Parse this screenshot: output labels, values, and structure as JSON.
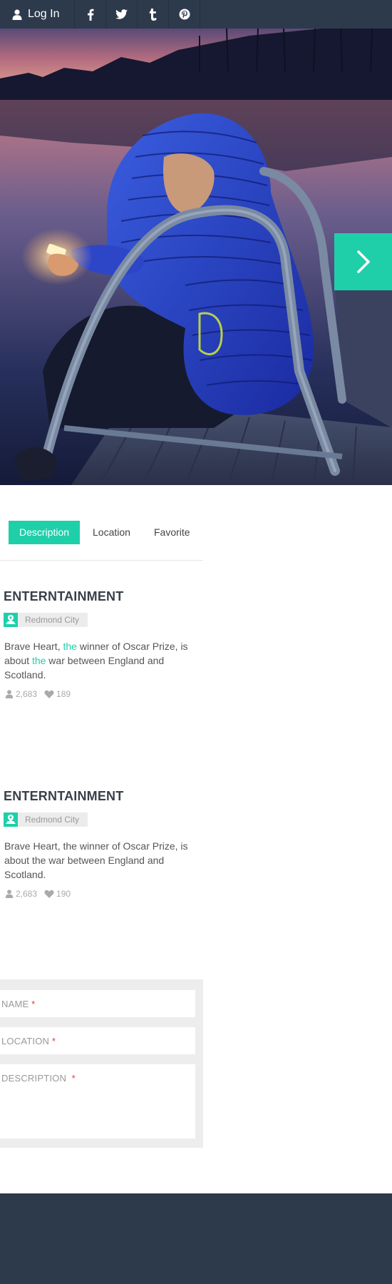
{
  "topbar": {
    "login_label": "Log In",
    "social": [
      {
        "icon": "facebook-icon",
        "glyph": "f"
      },
      {
        "icon": "twitter-icon",
        "glyph": "twitter"
      },
      {
        "icon": "tumblr-icon",
        "glyph": "t"
      },
      {
        "icon": "pinterest-icon",
        "glyph": "p"
      }
    ]
  },
  "tabs": [
    {
      "label": "Description",
      "active": true
    },
    {
      "label": "Location",
      "active": false
    },
    {
      "label": "Favorite",
      "active": false
    }
  ],
  "cards": [
    {
      "title": "ENTERNTAINMENT",
      "location": "Redmond City",
      "desc_parts": [
        "Brave Heart, ",
        "the",
        " winner of Oscar Prize, is about ",
        "the",
        " war between England and Scotland."
      ],
      "users": "2,683",
      "likes": "189"
    },
    {
      "title": "ENTERNTAINMENT",
      "location": "Redmond City",
      "description": "Brave Heart, the winner of Oscar Prize, is about the war between England and Scotland.",
      "users": "2,683",
      "likes": "190"
    }
  ],
  "form": {
    "name_label": "NAME",
    "location_label": "LOCATION",
    "description_label": "DESCRIPTION",
    "required_mark": "*"
  },
  "colors": {
    "accent": "#1fcfaa",
    "dark": "#2d3a4c",
    "required": "#e53935"
  }
}
